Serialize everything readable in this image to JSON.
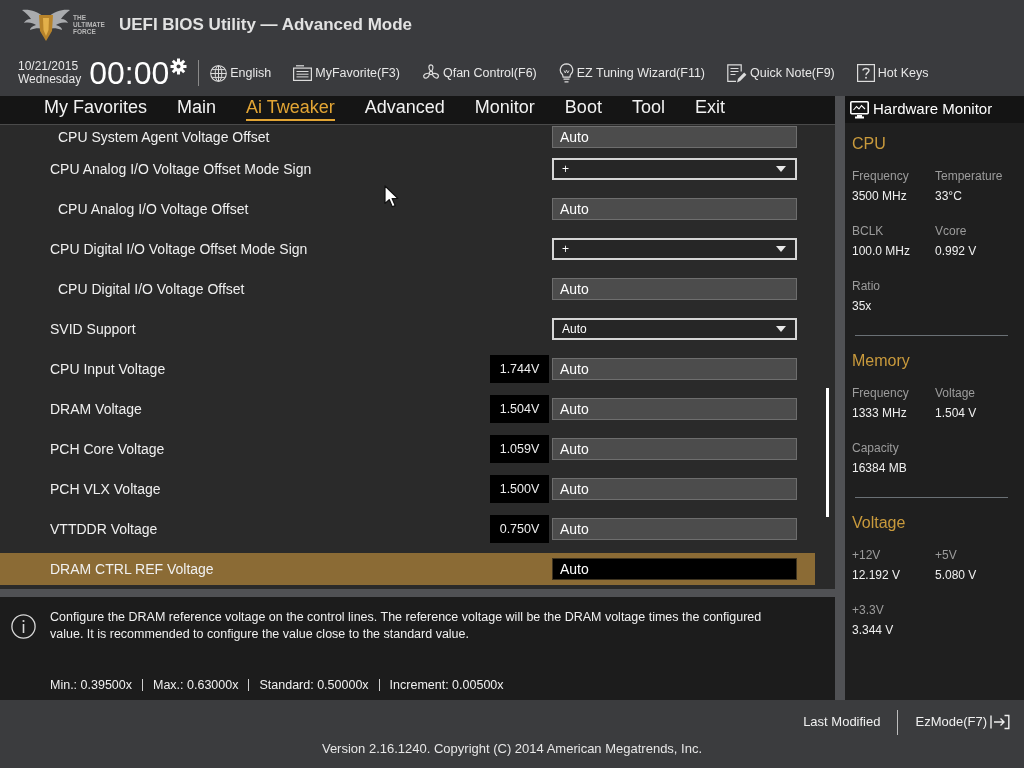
{
  "header": {
    "logo_lines": [
      "THE",
      "ULTIMATE",
      "FORCE"
    ],
    "title": "UEFI BIOS Utility — Advanced Mode"
  },
  "clock": {
    "date": "10/21/2015",
    "weekday": "Wednesday",
    "time": "00:00"
  },
  "toolbar": [
    "English",
    "MyFavorite(F3)",
    "Qfan Control(F6)",
    "EZ Tuning Wizard(F11)",
    "Quick Note(F9)",
    "Hot Keys"
  ],
  "tabs": [
    {
      "label": "My Favorites",
      "selected": false
    },
    {
      "label": "Main",
      "selected": false
    },
    {
      "label": "Ai Tweaker",
      "selected": true
    },
    {
      "label": "Advanced",
      "selected": false
    },
    {
      "label": "Monitor",
      "selected": false
    },
    {
      "label": "Boot",
      "selected": false
    },
    {
      "label": "Tool",
      "selected": false
    },
    {
      "label": "Exit",
      "selected": false
    }
  ],
  "settings": [
    {
      "children": [
        {
          "label": "CPU System Agent Voltage Offset",
          "kind": "field",
          "value": "Auto",
          "selected": false
        }
      ]
    },
    {
      "label": "CPU Analog I/O Voltage Offset Mode Sign",
      "kind": "dropdown",
      "value": "+",
      "selected": false,
      "children": [
        {
          "label": "CPU Analog I/O Voltage Offset",
          "kind": "field",
          "value": "Auto",
          "selected": false
        }
      ]
    },
    {
      "label": "CPU Digital I/O Voltage Offset Mode Sign",
      "kind": "dropdown",
      "value": "+",
      "selected": false,
      "children": [
        {
          "label": "CPU Digital I/O Voltage Offset",
          "kind": "field",
          "value": "Auto",
          "selected": false
        }
      ]
    },
    {
      "label": "SVID Support",
      "kind": "dropdown",
      "value": "Auto",
      "selected": false
    },
    {
      "label": "CPU Input Voltage",
      "kind": "field",
      "reading": "1.744V",
      "value": "Auto",
      "selected": false
    },
    {
      "label": "DRAM Voltage",
      "kind": "field",
      "reading": "1.504V",
      "value": "Auto",
      "selected": false
    },
    {
      "label": "PCH Core Voltage",
      "kind": "field",
      "reading": "1.059V",
      "value": "Auto",
      "selected": false
    },
    {
      "label": "PCH VLX Voltage",
      "kind": "field",
      "reading": "1.500V",
      "value": "Auto",
      "selected": false
    },
    {
      "label": "VTTDDR Voltage",
      "kind": "field",
      "reading": "0.750V",
      "value": "Auto",
      "selected": false
    },
    {
      "label": "DRAM CTRL REF Voltage",
      "kind": "field",
      "value": "Auto",
      "selected": true
    }
  ],
  "help": {
    "text": "Configure the DRAM reference voltage on the control lines. The reference voltage will be the DRAM voltage times the configured value. It is recommended to configure the value close to the standard value.",
    "limits": [
      "Min.: 0.39500x",
      "Max.: 0.63000x",
      "Standard: 0.50000x",
      "Increment: 0.00500x"
    ]
  },
  "hardware_monitor": {
    "title": "Hardware Monitor",
    "sections": [
      {
        "title": "CPU",
        "items": [
          {
            "label": "Frequency",
            "value": "3500 MHz"
          },
          {
            "label": "Temperature",
            "value": "33°C"
          },
          {
            "label": "BCLK",
            "value": "100.0 MHz"
          },
          {
            "label": "Vcore",
            "value": "0.992 V"
          },
          {
            "label": "Ratio",
            "value": "35x"
          }
        ]
      },
      {
        "title": "Memory",
        "items": [
          {
            "label": "Frequency",
            "value": "1333 MHz"
          },
          {
            "label": "Voltage",
            "value": "1.504 V"
          },
          {
            "label": "Capacity",
            "value": "16384 MB"
          }
        ]
      },
      {
        "title": "Voltage",
        "items": [
          {
            "label": "+12V",
            "value": "12.192 V"
          },
          {
            "label": "+5V",
            "value": "5.080 V"
          },
          {
            "label": "+3.3V",
            "value": "3.344 V"
          }
        ]
      }
    ]
  },
  "footer": {
    "last_modified": "Last Modified",
    "ez_mode": "EzMode(F7)",
    "version": "Version 2.16.1240. Copyright (C) 2014 American Megatrends, Inc."
  }
}
